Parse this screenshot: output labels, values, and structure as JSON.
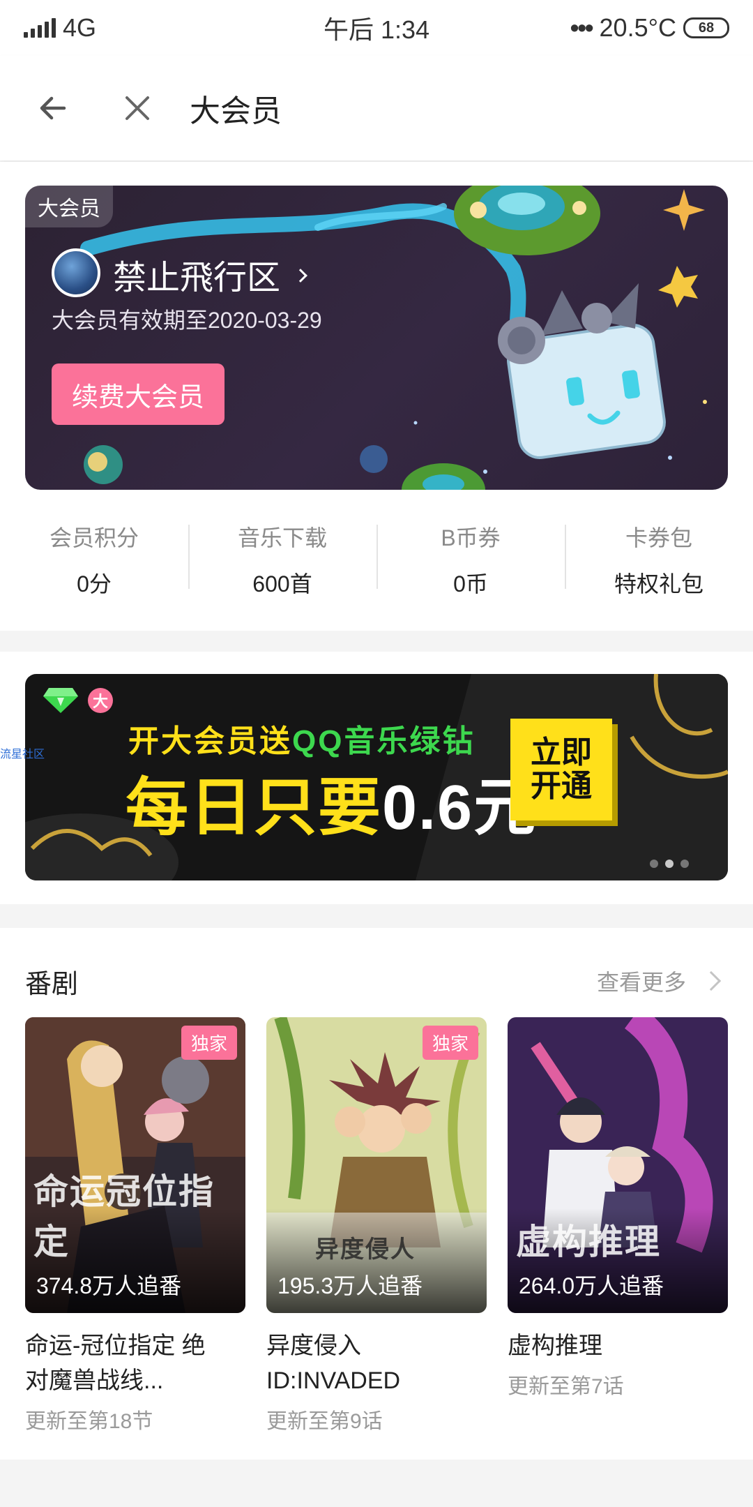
{
  "status_bar": {
    "network": "4G",
    "time": "午后 1:34",
    "dots": "•••",
    "temperature": "20.5°C",
    "battery": "68"
  },
  "top_bar": {
    "title": "大会员"
  },
  "member_card": {
    "tag": "大会员",
    "username": "禁止飛行区",
    "validity": "大会员有效期至2020-03-29",
    "renew_label": "续费大会员"
  },
  "stats": [
    {
      "label": "会员积分",
      "value": "0分"
    },
    {
      "label": "音乐下载",
      "value": "600首"
    },
    {
      "label": "B币券",
      "value": "0币"
    },
    {
      "label": "卡券包",
      "value": "特权礼包"
    }
  ],
  "promo_banner": {
    "badge": "大",
    "line1_prefix": "开大会员送",
    "line1_highlight": "QQ音乐绿钻",
    "line2_prefix": "每日只要",
    "line2_price": "0.6元",
    "cta_line1": "立即",
    "cta_line2": "开通",
    "page_count": 3,
    "active_page": 1
  },
  "side_watermark": "流星社区",
  "anime_section": {
    "title": "番剧",
    "see_more": "查看更多",
    "items": [
      {
        "poster_text": "命运冠位指定",
        "followers": "374.8万人追番",
        "badge": "独家",
        "title_line1": "命运-冠位指定 绝",
        "title_line2": "对魔兽战线...",
        "update": "更新至第18节"
      },
      {
        "poster_text": "异度侵人",
        "followers": "195.3万人追番",
        "badge": "独家",
        "title_line1": "异度侵入",
        "title_line2": "ID:INVADED",
        "update": "更新至第9话"
      },
      {
        "poster_text": "虚构推理",
        "followers": "264.0万人追番",
        "badge": "",
        "title_line1": "虚构推理",
        "title_line2": "",
        "update": "更新至第7话"
      }
    ]
  },
  "colors": {
    "accent_pink": "#fb7299",
    "promo_yellow": "#ffe01a",
    "promo_green": "#3dd84e"
  }
}
